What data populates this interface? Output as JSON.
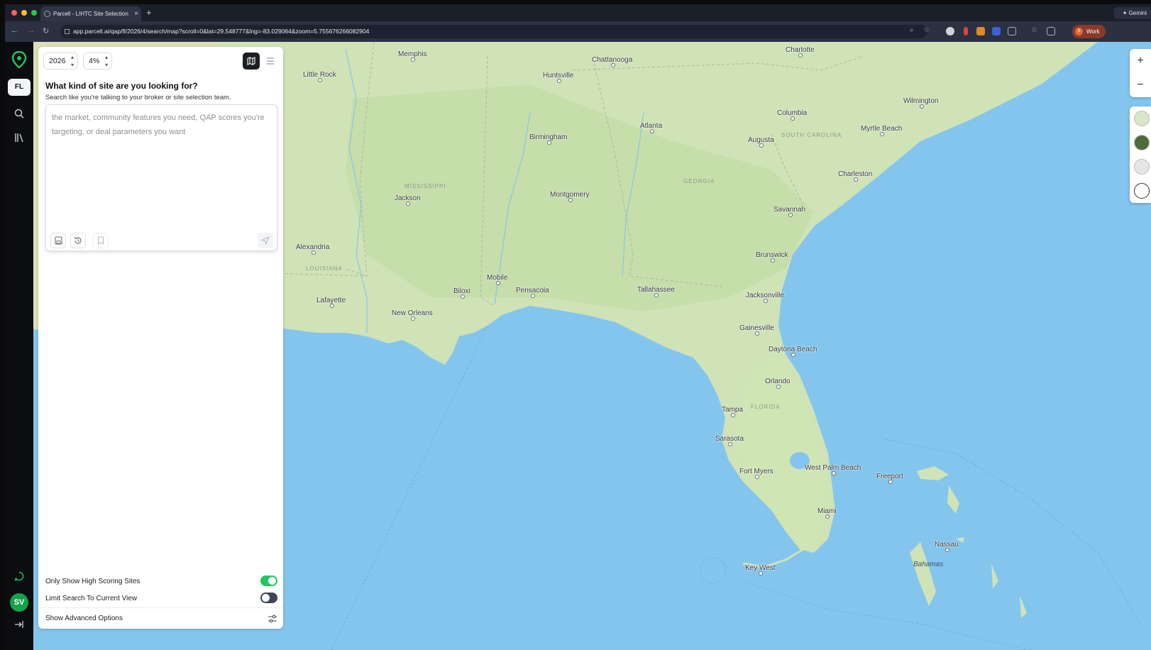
{
  "browser": {
    "tab_title": "Parcell - LIHTC Site Selection",
    "new_tab_symbol": "+",
    "close_symbol": "×",
    "url": "app.parcell.ai/qap/fl/2026/4/search/map?scroll=0&lat=29.548777&lng=-83.029064&zoom=5.755676266082904",
    "profile_label": "Work",
    "profile_initial": "S",
    "side_button_label": "Gemini",
    "traffic_colors": [
      "#ff5f57",
      "#febc2e",
      "#28c840"
    ]
  },
  "rail": {
    "state_badge": "FL",
    "avatar_initials": "SV",
    "accent": "#22c55e"
  },
  "panel": {
    "year": "2026",
    "rate": "4%",
    "title": "What kind of site are you looking for?",
    "subtitle": "Search like you're talking to your broker or site selection team.",
    "input_placeholder": "the market, community features you need, QAP scores you're targeting, or deal parameters you want",
    "toggles": [
      {
        "label": "Only Show High Scoring Sites",
        "on": true
      },
      {
        "label": "Limit Search To Current View",
        "on": false
      }
    ],
    "advanced_label": "Show Advanced Options",
    "toggle_on_color": "#22c55e",
    "toggle_off_color": "#3f4654"
  },
  "map": {
    "zoom_in": "+",
    "zoom_out": "−",
    "cities": [
      "Memphis",
      "Chattanooga",
      "Charlotte",
      "Little Rock",
      "Huntsville",
      "Wilmington",
      "Columbia",
      "Atlanta",
      "Myrtle Beach",
      "Birmingham",
      "Augusta",
      "Charleston",
      "Jackson",
      "Montgomery",
      "Savannah",
      "Alexandria",
      "Brunswick",
      "Mobile",
      "Biloxi",
      "Pensacola",
      "Tallahassee",
      "Jacksonville",
      "Lafayette",
      "New Orleans",
      "Gainesville",
      "Daytona Beach",
      "Orlando",
      "Tampa",
      "Sarasota",
      "Fort Myers",
      "West Palm Beach",
      "Freeport",
      "Miami",
      "Nassau",
      "Key West"
    ],
    "states": [
      "MISSISSIPPI",
      "GEORGIA",
      "SOUTH CAROLINA",
      "LOUISIANA",
      "FLORIDA"
    ],
    "islands": [
      "Bahamas"
    ]
  }
}
